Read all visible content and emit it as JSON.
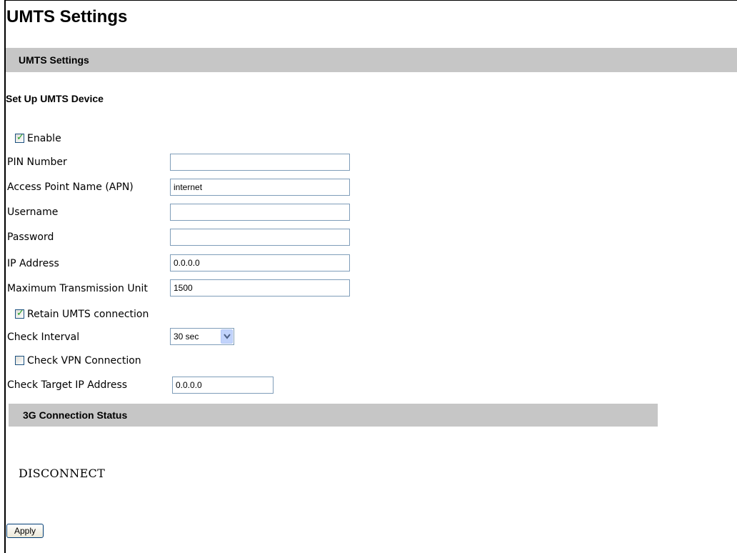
{
  "page": {
    "title": "UMTS Settings"
  },
  "section": {
    "title": "UMTS Settings",
    "subheading": "Set Up UMTS Device"
  },
  "form": {
    "enable": {
      "label": "Enable",
      "checked": true
    },
    "pin": {
      "label": "PIN Number",
      "value": ""
    },
    "apn": {
      "label": "Access Point Name (APN)",
      "value": "internet"
    },
    "username": {
      "label": "Username",
      "value": ""
    },
    "password": {
      "label": "Password",
      "value": ""
    },
    "ip_address": {
      "label": "IP Address",
      "value": "0.0.0.0"
    },
    "mtu": {
      "label": "Maximum Transmission Unit",
      "value": "1500"
    },
    "retain": {
      "label": "Retain UMTS connection",
      "checked": true
    },
    "check_interval": {
      "label": "Check Interval",
      "value": "30 sec"
    },
    "check_vpn": {
      "label": "Check VPN Connection",
      "checked": false
    },
    "target_ip": {
      "label": "Check Target IP Address",
      "value": "0.0.0.0"
    }
  },
  "status": {
    "title": "3G Connection Status",
    "value": "DISCONNECT"
  },
  "actions": {
    "apply_label": "Apply"
  },
  "colors": {
    "section_bar": "#c6c6c6",
    "checkmark": "#21a121",
    "input_border": "#7f9db9"
  }
}
